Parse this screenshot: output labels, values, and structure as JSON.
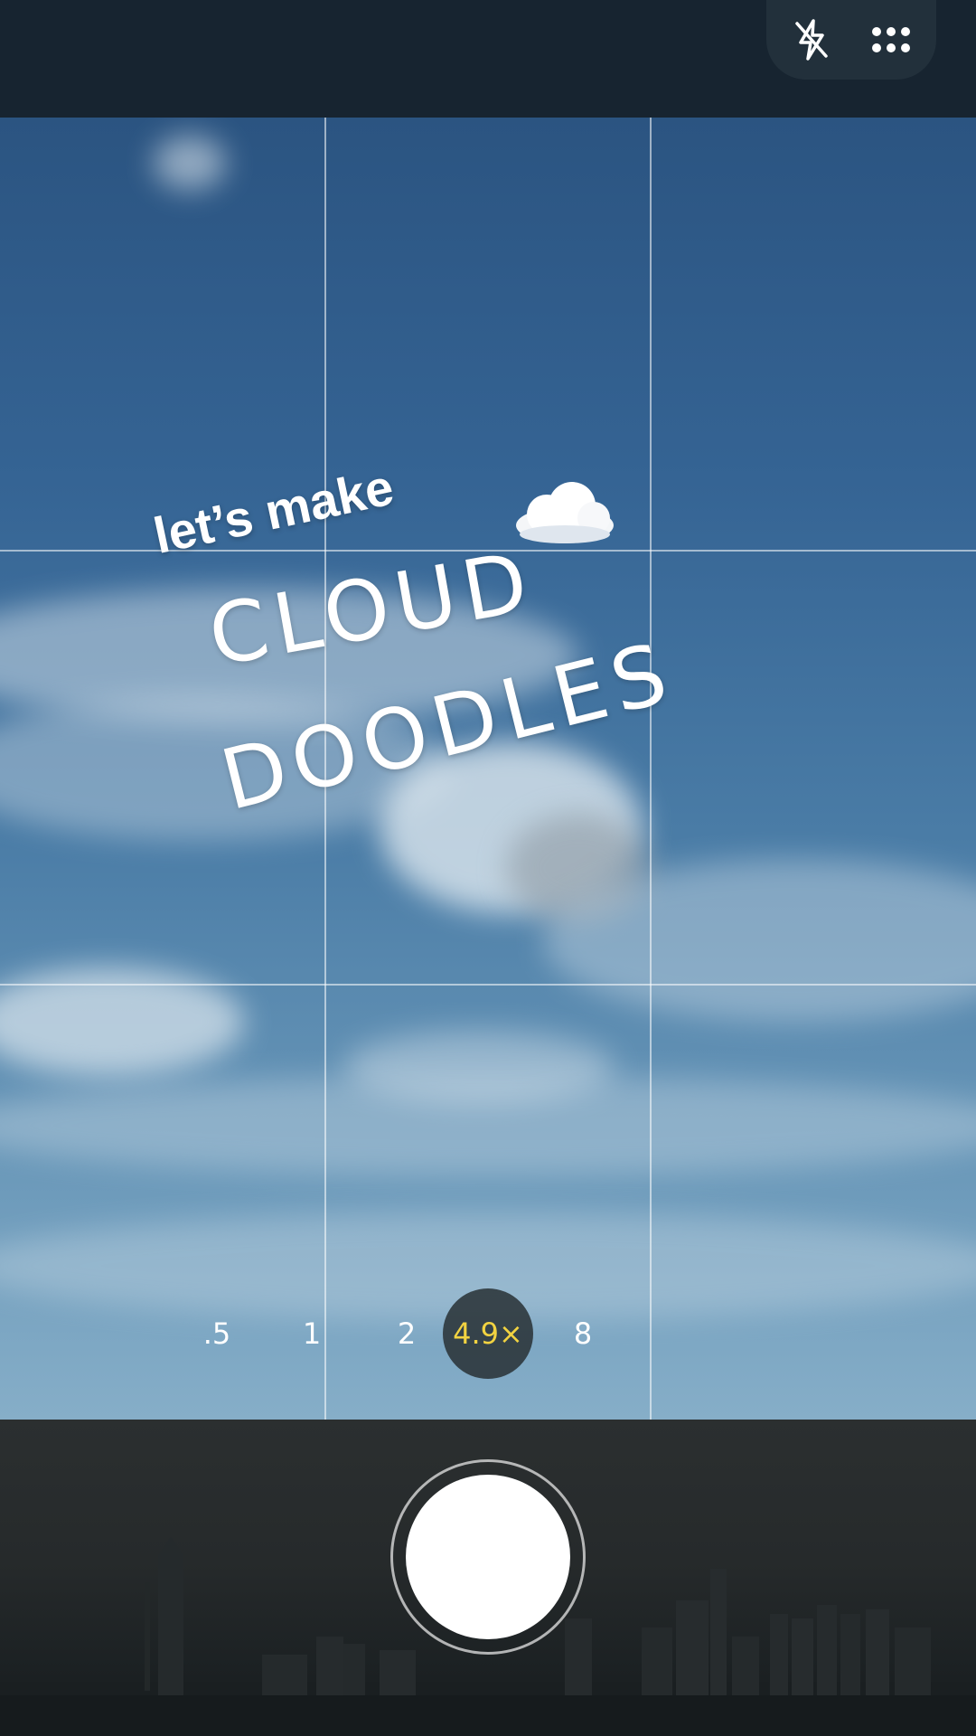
{
  "top_bar": {
    "flash_icon": "flash-off-icon",
    "more_icon": "more-dots-icon"
  },
  "overlay": {
    "line1": "let’s make",
    "line2": "CLOUD",
    "line3": "DOODLES",
    "sticker": "cloud-emoji"
  },
  "zoom": {
    "options": [
      ".5",
      "1",
      "2",
      "4.9×",
      "8"
    ],
    "active_index": 3,
    "active_color": "#f2d341"
  },
  "controls": {
    "shutter_icon": "shutter-button"
  }
}
